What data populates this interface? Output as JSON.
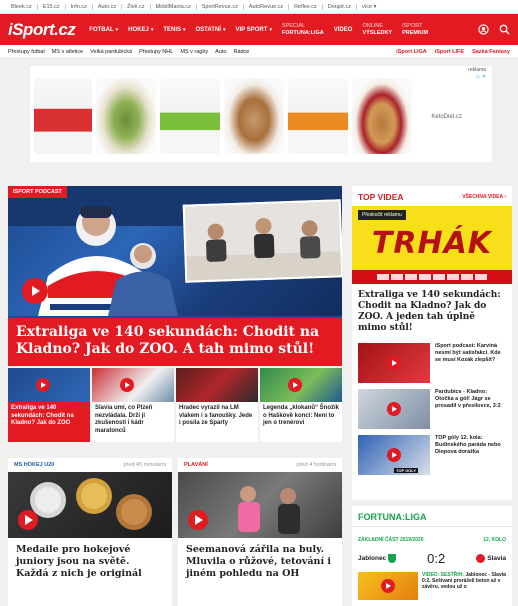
{
  "portal": [
    "Bleek.cz",
    "E15.cz",
    "Info.cz",
    "Auto.cz",
    "Živě.cz",
    "MobilMania.cz",
    "SportRevue.cz",
    "AutoRevue.cz",
    "Reflex.cz",
    "Doupě.cz",
    "více"
  ],
  "nav": {
    "logo": "iSport.cz",
    "items": [
      "FOTBAL",
      "HOKEJ",
      "TENIS",
      "OSTATNÍ",
      "VIP SPORT"
    ],
    "special_top": "SPECIÁL",
    "special_bottom": "FORTUNA:LIGA",
    "video": "VIDEO",
    "online_top": "ONLINE",
    "online_bottom": "VÝSLEDKY",
    "premium_top": "ISPORT",
    "premium_bottom": "PREMIUM"
  },
  "subnav": {
    "left": [
      "Přestupy fotbal",
      "MS v atletice",
      "Velká pardubická",
      "Přestupy NHL",
      "MS v ragby",
      "Auto",
      "Rádce"
    ],
    "right": [
      "iSport LIGA",
      "iSport LIFE",
      "Sazka Fantasy"
    ]
  },
  "ad": {
    "label": "reklama",
    "close": "▷ ✕",
    "text": "KetoDiet.cz"
  },
  "feature": {
    "badge": "ISPORT PODCAST",
    "headline": "Extraliga ve 140 sekundách: Chodit na Kladno? Jak do ZOO. A tah mimo stůl!"
  },
  "thumbs": [
    "Extraliga ve 140 sekundách: Chodit na Kladno? Jak do ZOO",
    "Slavia umí, co Plzeň nezvládala. Drží ji zkušenosti i kádr maratonců",
    "Hradec vyrazil na LM vlakem i s fanoušky. Jede i posila ze Sparty",
    "Legenda „klokanů“ Šnožík o Haškově konci: Není to jen o trenérovi"
  ],
  "cards": [
    {
      "tag": "MS HOKEJ U20",
      "time": "před 45 minutami",
      "title": "Medaile pro hokejové juniory jsou na světě. Každá z nich je originál"
    },
    {
      "tag": "PLAVÁNÍ",
      "time": "před 4 hodinami",
      "title": "Seemanová zářila na buly. Mluvila o růžové, tetování i jiném pohledu na OH"
    }
  ],
  "side": {
    "title": "TOP VIDEA",
    "all": "VŠECHNA VIDEA ›",
    "skip": "Přeskočit reklamu",
    "ad_word": "TRHÁK",
    "video_title": "Extraliga ve 140 sekundách: Chodit na Kladno? Jak do ZOO. A jeden tah úplně mimo stůl!",
    "items": [
      "iSport podcast: Karviná nesmí být satisfakcí. Kde se musí Kozák zlepšit?",
      "Pardubice - Kladno: Otočka a gól! Jágr se prosadil v přesilovce, 3:2",
      "TOP góly 12. kola: Budínského paráda nebo Diopova doražka"
    ],
    "thumb_label": "TOP GÓLY"
  },
  "fortuna": {
    "title": "FORTUNA:LIGA",
    "phase": "ZÁKLADNÍ ČÁST 2019/2020",
    "round": "12. KOLO",
    "home": "Jablonec",
    "away": "Slavia",
    "score": "0:2",
    "video_label": "VIDEO: SESTŘIH:",
    "video_text": "Jablonec - Slavia 0:2. Sešívaní proráželi beton až v závěru, vedou už o"
  },
  "colors": {
    "brand": "#e21a22",
    "fortuna": "#16a34a"
  }
}
